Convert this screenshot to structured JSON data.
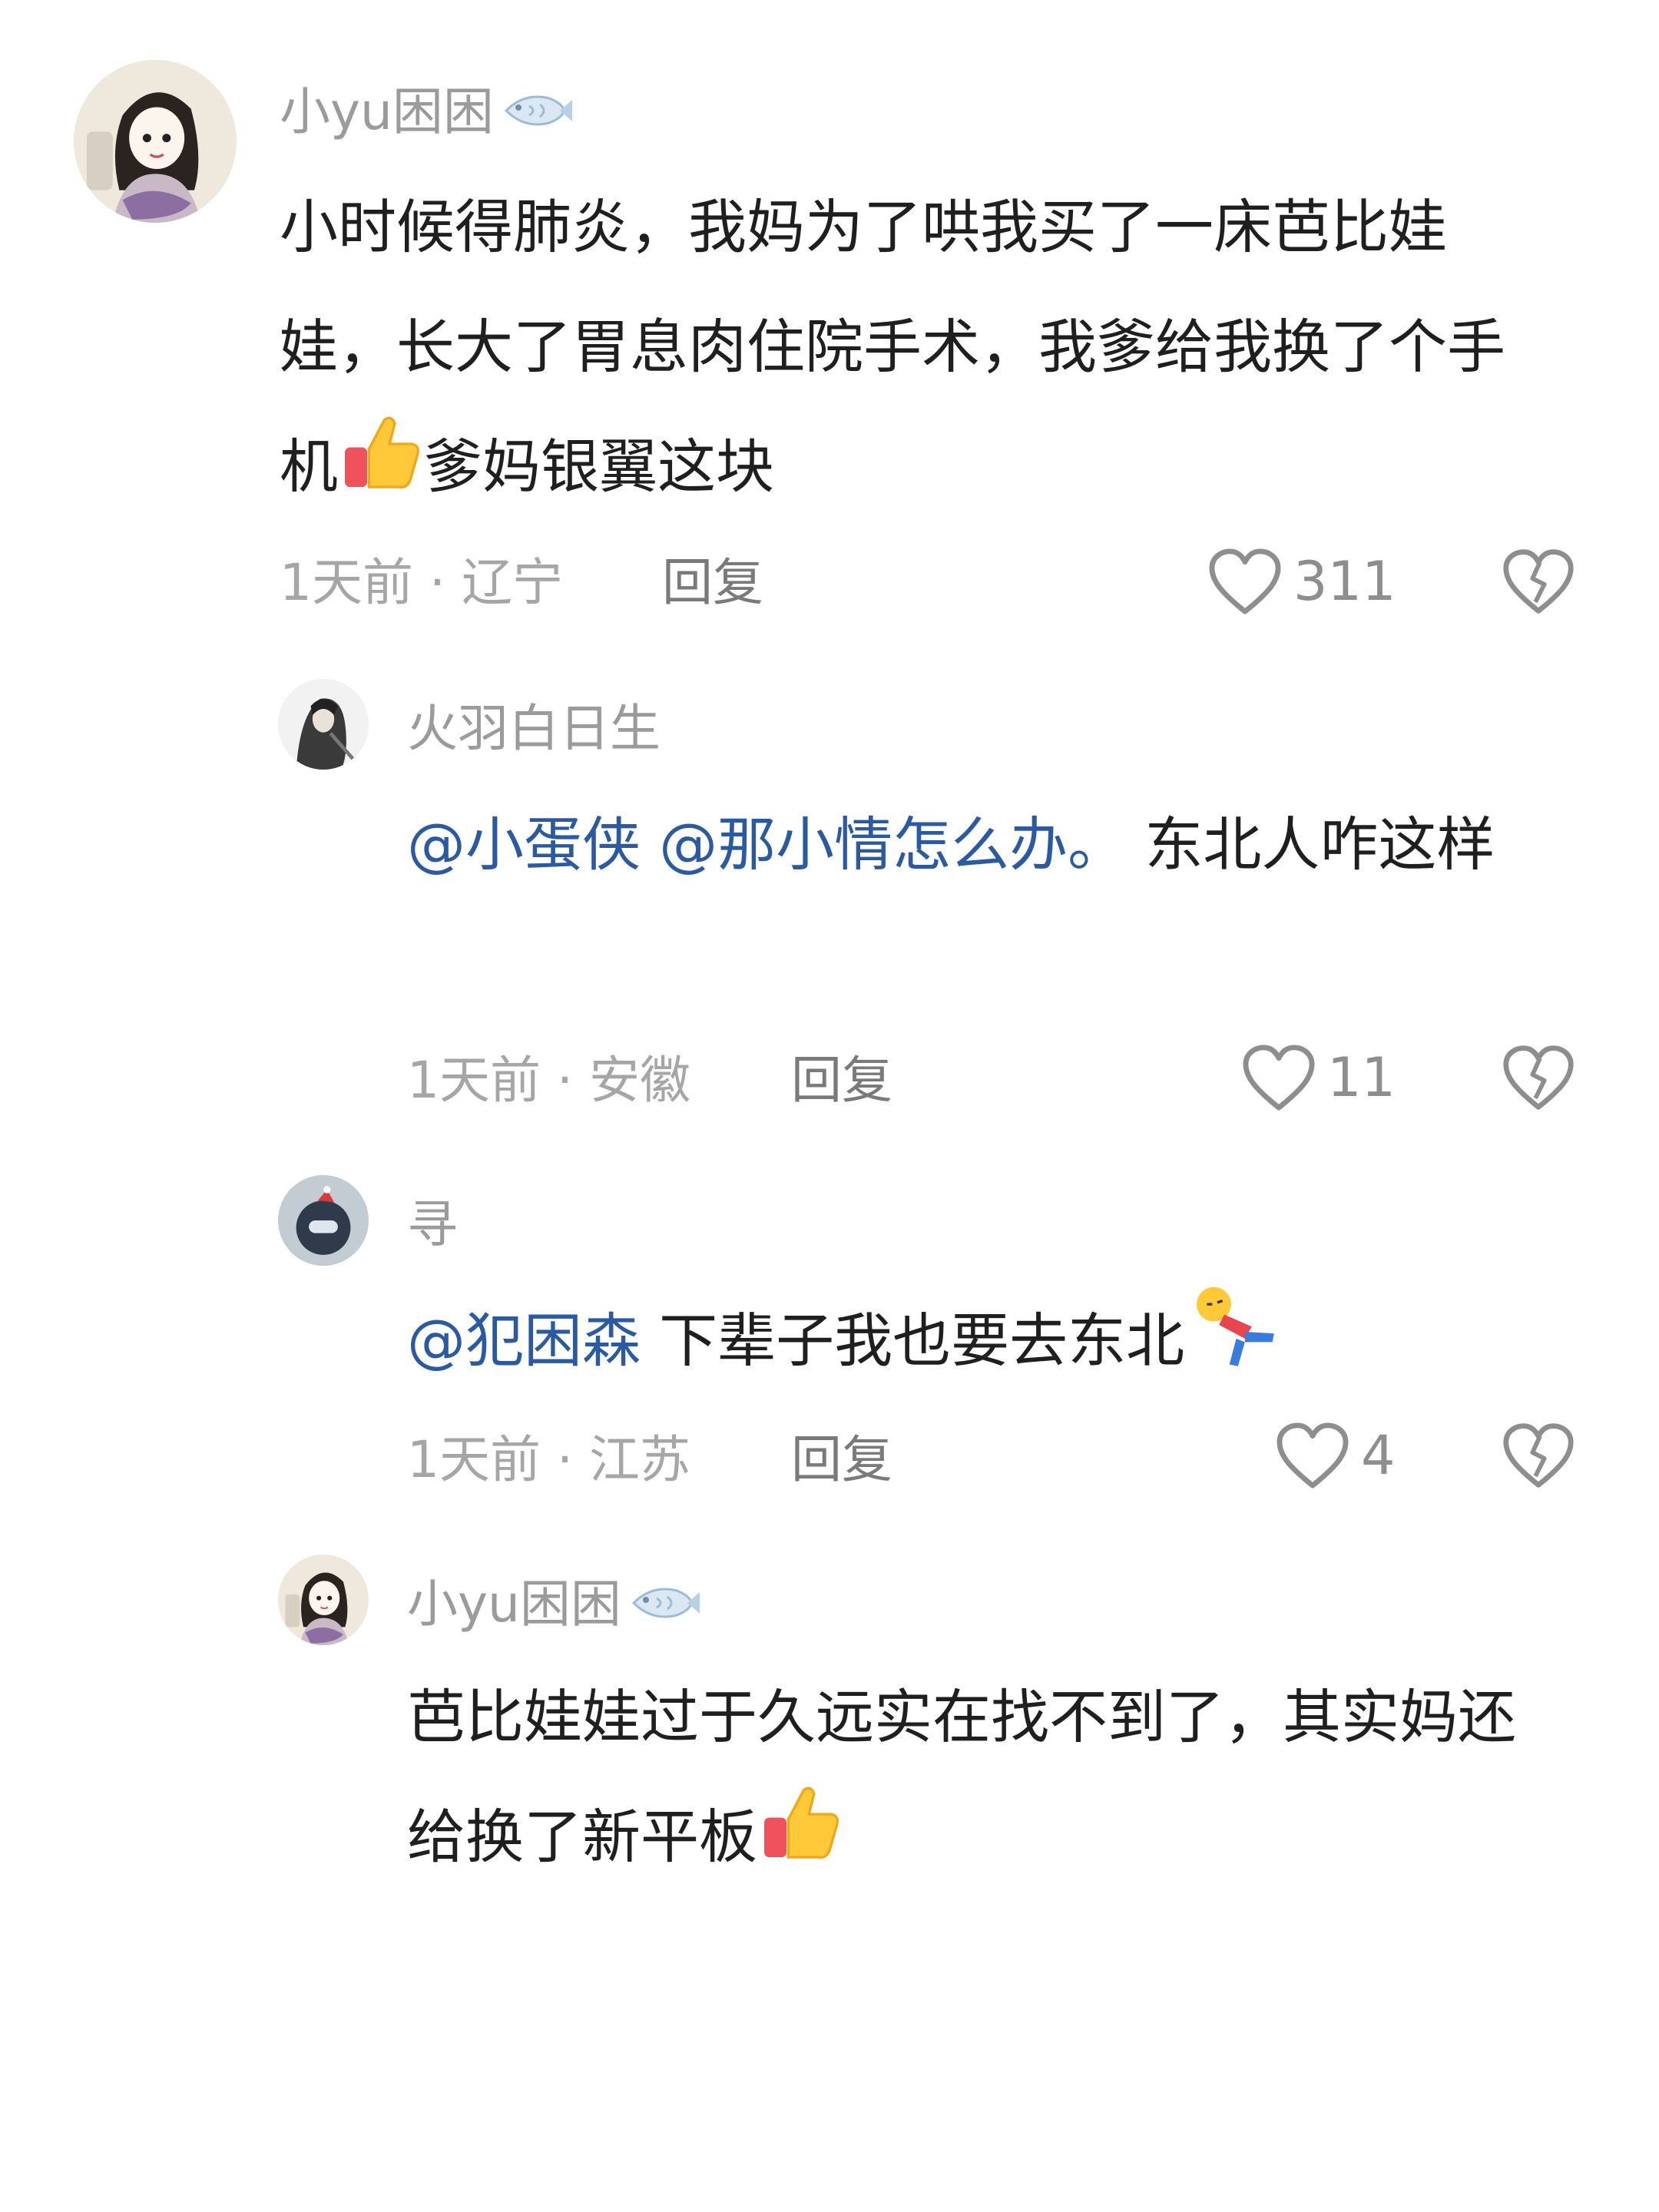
{
  "comments": [
    {
      "username": "小yu困困",
      "text_parts": [
        "小时候得肺炎，我妈为了哄我买了一床芭比娃娃，长大了胃息肉住院手术，我爹给我换了个手机",
        "爹妈银翼这块"
      ],
      "time": "1天前",
      "location": "辽宁",
      "reply": "回复",
      "likes": "311"
    },
    {
      "username": "火羽白日生",
      "mention1": "@小蛋侠",
      "mention2": "@那小情怎么办。",
      "text": "东北人咋这样",
      "time": "1天前",
      "location": "安徽",
      "reply": "回复",
      "likes": "11"
    },
    {
      "username": "寻",
      "mention1": "@犯困森",
      "text": "下辈子我也要去东北",
      "time": "1天前",
      "location": "江苏",
      "reply": "回复",
      "likes": "4"
    },
    {
      "username": "小yu困困",
      "text": "芭比娃娃过于久远实在找不到了，其实妈还给换了新平板",
      "time": "",
      "location": "",
      "reply": "",
      "likes": ""
    }
  ],
  "meta_separator": " · ",
  "icons": {
    "like": "heart-outline-icon",
    "dislike": "broken-heart-icon",
    "thumbs_up": "thumbs-up-emoji",
    "fish": "fish-badge-icon",
    "fall": "falling-person-emoji"
  },
  "colors": {
    "mention": "#2c5aa0",
    "body_text": "#1f1f1f",
    "muted": "#a6a6a6"
  }
}
